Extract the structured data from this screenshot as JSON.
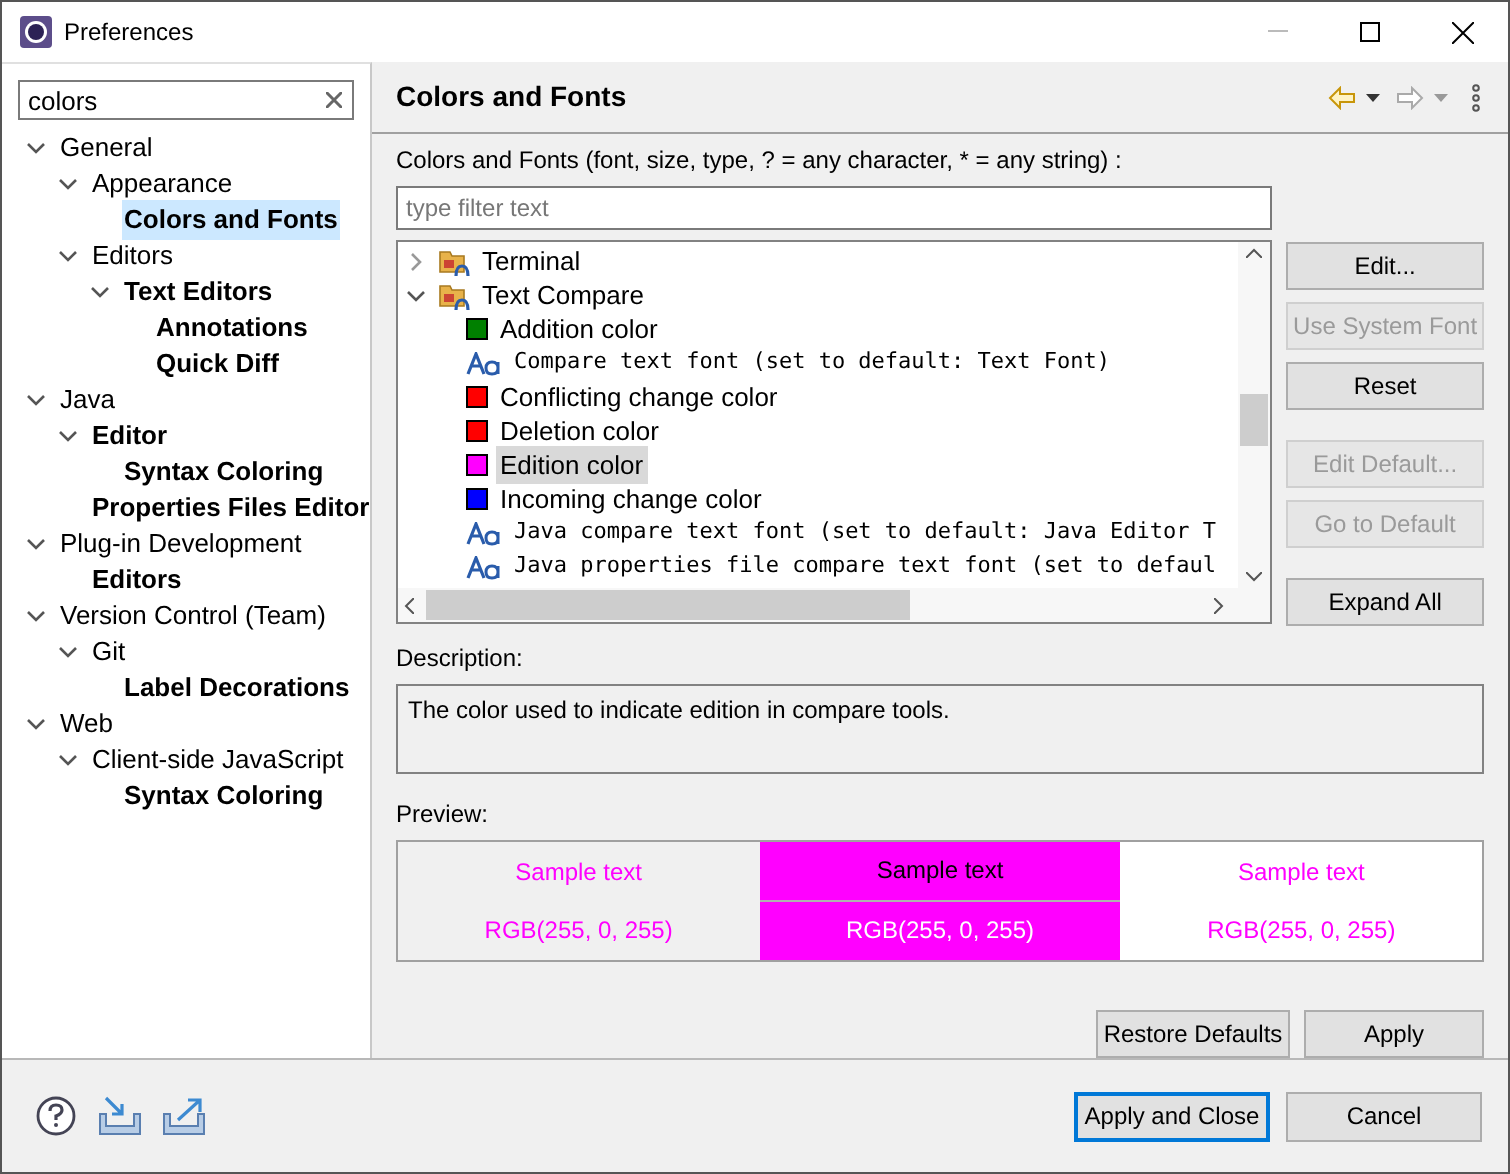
{
  "window": {
    "title": "Preferences"
  },
  "search": {
    "value": "colors"
  },
  "tree": [
    {
      "label": "General",
      "bold": false,
      "expanded": true,
      "selected": false,
      "children": [
        {
          "label": "Appearance",
          "bold": false,
          "expanded": true,
          "selected": false,
          "children": [
            {
              "label": "Colors and Fonts",
              "bold": true,
              "selected": true
            }
          ]
        },
        {
          "label": "Editors",
          "bold": false,
          "expanded": true,
          "selected": false,
          "children": [
            {
              "label": "Text Editors",
              "bold": true,
              "expanded": true,
              "selected": false,
              "children": [
                {
                  "label": "Annotations",
                  "bold": true,
                  "selected": false
                },
                {
                  "label": "Quick Diff",
                  "bold": true,
                  "selected": false
                }
              ]
            }
          ]
        }
      ]
    },
    {
      "label": "Java",
      "bold": false,
      "expanded": true,
      "selected": false,
      "children": [
        {
          "label": "Editor",
          "bold": true,
          "expanded": true,
          "selected": false,
          "children": [
            {
              "label": "Syntax Coloring",
              "bold": true,
              "selected": false
            }
          ]
        },
        {
          "label": "Properties Files Editor",
          "bold": true,
          "selected": false
        }
      ]
    },
    {
      "label": "Plug-in Development",
      "bold": false,
      "expanded": true,
      "selected": false,
      "children": [
        {
          "label": "Editors",
          "bold": true,
          "selected": false
        }
      ]
    },
    {
      "label": "Version Control (Team)",
      "bold": false,
      "expanded": true,
      "selected": false,
      "children": [
        {
          "label": "Git",
          "bold": false,
          "expanded": true,
          "selected": false,
          "children": [
            {
              "label": "Label Decorations",
              "bold": true,
              "selected": false
            }
          ]
        }
      ]
    },
    {
      "label": "Web",
      "bold": false,
      "expanded": true,
      "selected": false,
      "children": [
        {
          "label": "Client-side JavaScript",
          "bold": false,
          "expanded": true,
          "selected": false,
          "children": [
            {
              "label": "Syntax Coloring",
              "bold": true,
              "selected": false
            }
          ]
        }
      ]
    }
  ],
  "page": {
    "title": "Colors and Fonts",
    "filter_label": "Colors and Fonts (font, size, type, ? = any character, * = any string) :",
    "filter": {
      "placeholder": "type filter text"
    },
    "items": [
      {
        "kind": "category",
        "label": "Terminal",
        "expanded": false,
        "selected": false
      },
      {
        "kind": "category",
        "label": "Text Compare",
        "expanded": true,
        "selected": false,
        "children": [
          {
            "kind": "color",
            "label": "Addition color",
            "color": "#008000",
            "selected": false
          },
          {
            "kind": "font",
            "label": "Compare text font (set to default: Text Font)",
            "selected": false
          },
          {
            "kind": "color",
            "label": "Conflicting change color",
            "color": "#ff0000",
            "selected": false
          },
          {
            "kind": "color",
            "label": "Deletion color",
            "color": "#ff0000",
            "selected": false
          },
          {
            "kind": "color",
            "label": "Edition color",
            "color": "#ff00ff",
            "selected": true
          },
          {
            "kind": "color",
            "label": "Incoming change color",
            "color": "#0000ff",
            "selected": false
          },
          {
            "kind": "font",
            "label": "Java compare text font (set to default: Java Editor T",
            "selected": false
          },
          {
            "kind": "font",
            "label": "Java properties file compare text font (set to defaul",
            "selected": false
          }
        ]
      }
    ],
    "buttons": [
      {
        "label": "Edit...",
        "disabled": false
      },
      {
        "label": "Use System Font",
        "disabled": true
      },
      {
        "label": "Reset",
        "disabled": false
      },
      {
        "label": "Edit Default...",
        "disabled": true
      },
      {
        "label": "Go to Default",
        "disabled": true
      },
      {
        "label": "Expand All",
        "disabled": false
      }
    ],
    "description_label": "Description:",
    "description": "The color used to indicate edition in compare tools.",
    "preview_label": "Preview:",
    "preview": [
      {
        "kind": "plain",
        "color": "#ff00ff",
        "sample": "Sample text",
        "rgb": "RGB(255, 0, 255)"
      },
      {
        "kind": "filled",
        "color": "#ff00ff",
        "sample": "Sample text",
        "rgb": "RGB(255, 0, 255)"
      },
      {
        "kind": "white",
        "color": "#ff00ff",
        "sample": "Sample text",
        "rgb": "RGB(255, 0, 255)"
      }
    ],
    "page_buttons": [
      "Restore Defaults",
      "Apply"
    ]
  },
  "dialog_buttons": [
    {
      "label": "Apply and Close",
      "default": true
    },
    {
      "label": "Cancel",
      "default": false
    }
  ]
}
